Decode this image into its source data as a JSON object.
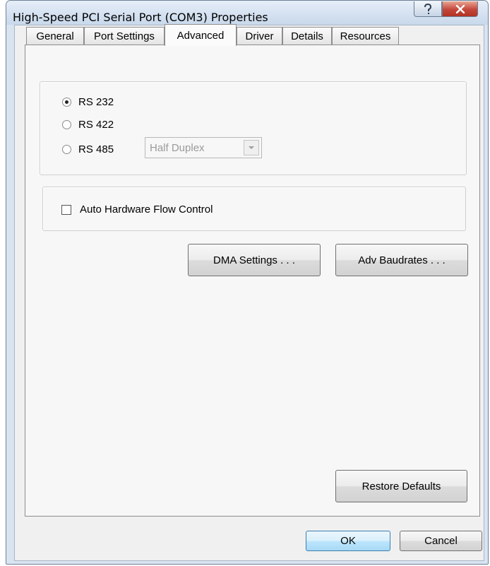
{
  "window": {
    "title": "High-Speed PCI Serial Port (COM3) Properties"
  },
  "tabs": [
    {
      "label": "General",
      "active": false
    },
    {
      "label": "Port Settings",
      "active": false
    },
    {
      "label": "Advanced",
      "active": true
    },
    {
      "label": "Driver",
      "active": false
    },
    {
      "label": "Details",
      "active": false
    },
    {
      "label": "Resources",
      "active": false
    }
  ],
  "interface": {
    "options": [
      {
        "label": "RS 232",
        "checked": true
      },
      {
        "label": "RS 422",
        "checked": false
      },
      {
        "label": "RS 485",
        "checked": false
      }
    ],
    "duplex_select": {
      "value": "Half Duplex",
      "enabled": false
    }
  },
  "flow_control": {
    "label": "Auto Hardware Flow Control",
    "checked": false
  },
  "buttons": {
    "dma_settings": "DMA Settings . . .",
    "adv_baudrates": "Adv Baudrates . . .",
    "restore_defaults": "Restore Defaults",
    "ok": "OK",
    "cancel": "Cancel"
  },
  "icons": {
    "help": "question-mark-icon",
    "close": "close-x-icon",
    "dropdown": "chevron-down-icon"
  },
  "colors": {
    "window_frame": "#d9e4f1",
    "close_button": "#c4463a",
    "default_button_border": "#3c7fb1"
  }
}
